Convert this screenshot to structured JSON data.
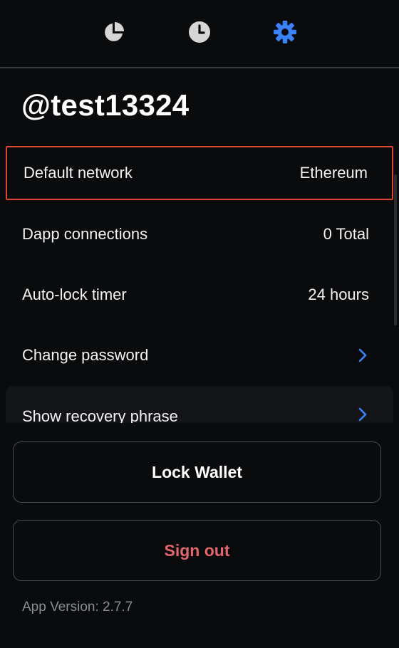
{
  "colors": {
    "background": "#0a0b0d",
    "accent": "#3b82f6",
    "inactive_icon": "#d6d6d6",
    "highlight_border": "#d9482d",
    "signout_text": "#e0676c"
  },
  "tabs": [
    {
      "icon": "pie-chart-icon",
      "active": false
    },
    {
      "icon": "clock-icon",
      "active": false
    },
    {
      "icon": "gear-icon",
      "active": true
    }
  ],
  "profile": {
    "username": "@test13324"
  },
  "settings": {
    "items": [
      {
        "label": "Default network",
        "value": "Ethereum"
      },
      {
        "label": "Dapp connections",
        "value": "0 Total"
      },
      {
        "label": "Auto-lock timer",
        "value": "24 hours"
      },
      {
        "label": "Change password",
        "icon": "chevron-right-icon"
      },
      {
        "label": "Show recovery phrase",
        "icon": "chevron-right-icon"
      }
    ]
  },
  "actions": {
    "lock_label": "Lock Wallet",
    "signout_label": "Sign out"
  },
  "footer": {
    "version": "App Version: 2.7.7"
  }
}
